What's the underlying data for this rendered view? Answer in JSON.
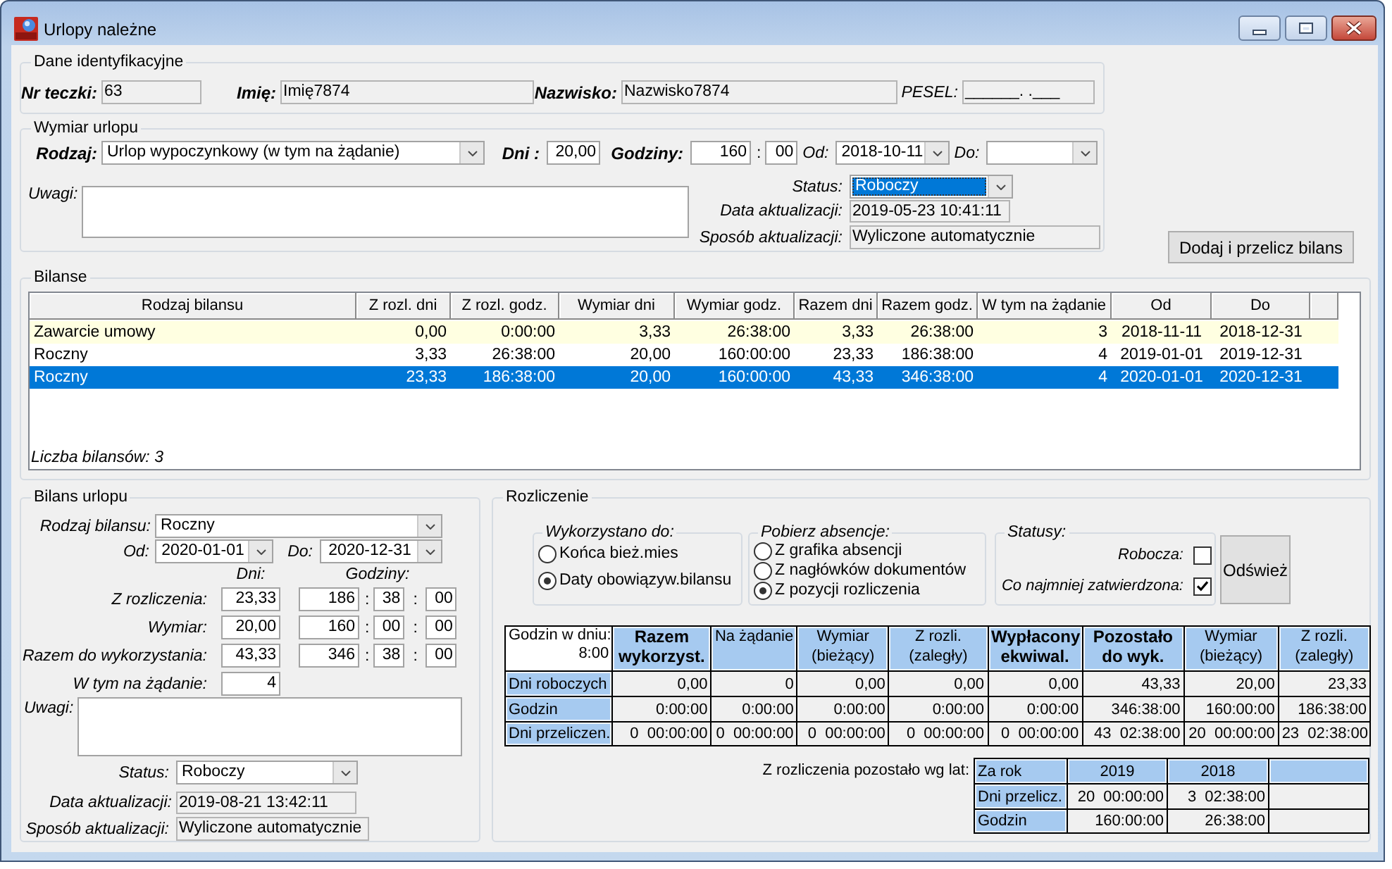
{
  "window": {
    "title": "Urlopy należne"
  },
  "identification": {
    "legend": "Dane identyfikacyjne",
    "fields": [
      {
        "label": "Nr teczki:",
        "value": "63",
        "required": true,
        "readonly": true
      },
      {
        "label": "Imię:",
        "value": "Imię7874",
        "required": true,
        "readonly": true
      },
      {
        "label": "Nazwisko:",
        "value": "Nazwisko7874",
        "required": true,
        "readonly": true
      },
      {
        "label": "PESEL:",
        "value": "______. .___",
        "required": false,
        "readonly": true
      }
    ]
  },
  "leave": {
    "legend": "Wymiar urlopu",
    "type": {
      "label": "Rodzaj:",
      "value": "Urlop wypoczynkowy (w tym na żądanie)",
      "required": true
    },
    "days": {
      "label": "Dni :",
      "value": "20,00",
      "required": true
    },
    "hours": {
      "label": "Godziny:",
      "parts": [
        "160",
        ":",
        "00"
      ],
      "required": true
    },
    "from": {
      "label": "Od:",
      "value": "2018-10-11",
      "required": false
    },
    "to": {
      "label": "Do:",
      "required": false
    },
    "notes": {
      "label": "Uwagi:"
    },
    "status": {
      "label": "Status:",
      "value": "Roboczy",
      "focused": true
    },
    "updated": {
      "label": "Data aktualizacji:",
      "value": "2019-05-23 10:41:11",
      "readonly": true
    },
    "update_method": {
      "label": "Sposób aktualizacji:",
      "value": "Wyliczone automatycznie",
      "readonly": true
    }
  },
  "add_button": {
    "label": "Dodaj i przelicz bilans"
  },
  "balances": {
    "legend": "Bilanse",
    "columns": [
      "Rodzaj bilansu",
      "Z rozl. dni",
      "Z rozl. godz.",
      "Wymiar dni",
      "Wymiar godz.",
      "Razem dni",
      "Razem godz.",
      "W tym na żądanie",
      "Od",
      "Do"
    ],
    "rows": [
      {
        "cells": [
          "Zawarcie umowy",
          "0,00",
          "0:00:00",
          "3,33",
          "26:38:00",
          "3,33",
          "26:38:00",
          "3",
          "2018-11-11",
          "2018-12-31"
        ],
        "highlight": true,
        "selected": false
      },
      {
        "cells": [
          "Roczny",
          "3,33",
          "26:38:00",
          "20,00",
          "160:00:00",
          "23,33",
          "186:38:00",
          "4",
          "2019-01-01",
          "2019-12-31"
        ],
        "highlight": false,
        "selected": false
      },
      {
        "cells": [
          "Roczny",
          "23,33",
          "186:38:00",
          "20,00",
          "160:00:00",
          "43,33",
          "346:38:00",
          "4",
          "2020-01-01",
          "2020-12-31"
        ],
        "highlight": false,
        "selected": true
      }
    ],
    "count": "Liczba bilansów: 3"
  },
  "balance": {
    "legend": "Bilans urlopu",
    "type": {
      "label": "Rodzaj bilansu:",
      "value": "Roczny"
    },
    "from": {
      "label": "Od:",
      "value": "2020-01-01"
    },
    "to": {
      "label": "Do:",
      "value": "2020-12-31"
    },
    "days_header": "Dni:",
    "hours_header": "Godziny:",
    "rows": [
      {
        "label": "Z rozliczenia:",
        "days": "23,33",
        "time": [
          "186",
          ":",
          "38",
          ":",
          "00"
        ]
      },
      {
        "label": "Wymiar:",
        "days": "20,00",
        "time": [
          "160",
          ":",
          "00",
          ":",
          "00"
        ]
      },
      {
        "label": "Razem do wykorzystania:",
        "days": "43,33",
        "time": [
          "346",
          ":",
          "38",
          ":",
          "00"
        ]
      },
      {
        "label": "W tym na żądanie:",
        "days": "4"
      }
    ],
    "notes": {
      "label": "Uwagi:"
    },
    "status": {
      "label": "Status:",
      "value": "Roboczy"
    },
    "updated": {
      "label": "Data aktualizacji:",
      "value": "2019-08-21 13:42:11",
      "readonly": true
    },
    "update_method": {
      "label": "Sposób aktualizacji:",
      "value": "Wyliczone automatycznie",
      "readonly": true
    }
  },
  "settlement": {
    "legend": "Rozliczenie",
    "used_until": {
      "legend": "Wykorzystano do:",
      "options": [
        {
          "label": "Końca bież.mies",
          "selected": false
        },
        {
          "label": "Daty obowiązyw.bilansu",
          "selected": true
        }
      ]
    },
    "absences": {
      "legend": "Pobierz absencje:",
      "options": [
        {
          "label": "Z grafika absencji",
          "selected": false
        },
        {
          "label": "Z nagłówków dokumentów",
          "selected": false
        },
        {
          "label": "Z pozycji rozliczenia",
          "selected": true
        }
      ]
    },
    "statuses": {
      "legend": "Statusy:",
      "items": [
        {
          "label": "Robocza:",
          "checked": false
        },
        {
          "label": "Co najmniej zatwierdzona:",
          "checked": true
        }
      ]
    },
    "refresh_button": {
      "label": "Odśwież"
    },
    "summary": {
      "corner": {
        "label": "Godzin w dniu:",
        "value": "8:00"
      },
      "columns": [
        "Razem wykorzyst.",
        "Na żądanie",
        "Wymiar (bieżący)",
        "Z rozli. (zaległy)",
        "Wypłacony ekwiwal.",
        "Pozostało do wyk.",
        "Wymiar (bieżący)",
        "Z rozli. (zaległy)"
      ],
      "rows": [
        {
          "label": "Dni roboczych",
          "cells": [
            "0,00",
            "0",
            "0,00",
            "0,00",
            "0,00",
            "43,33",
            "20,00",
            "23,33"
          ]
        },
        {
          "label": "Godzin",
          "cells": [
            "0:00:00",
            "0:00:00",
            "0:00:00",
            "0:00:00",
            "0:00:00",
            "346:38:00",
            "160:00:00",
            "186:38:00"
          ]
        },
        {
          "label": "Dni przeliczen.",
          "cells": [
            "0  00:00:00",
            "0  00:00:00",
            "0  00:00:00",
            "0  00:00:00",
            "0  00:00:00",
            "43  02:38:00",
            "20  00:00:00",
            "23  02:38:00"
          ]
        }
      ]
    },
    "by_year": {
      "label": "Z rozliczenia pozostało wg lat:",
      "corner": "Za rok",
      "columns": [
        "2019",
        "2018"
      ],
      "rows": [
        {
          "label": "Dni przelicz.",
          "cells": [
            "20  00:00:00",
            "3  02:38:00"
          ]
        },
        {
          "label": "Godzin",
          "cells": [
            "160:00:00",
            "26:38:00"
          ]
        }
      ]
    }
  }
}
